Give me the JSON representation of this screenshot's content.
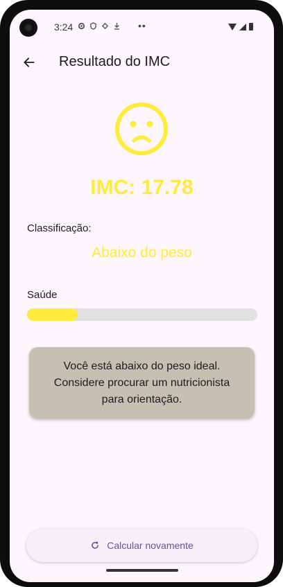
{
  "status_bar": {
    "time": "3:24",
    "dots": "••"
  },
  "app_bar": {
    "title": "Resultado do IMC"
  },
  "result": {
    "imc_text": "IMC: 17.78",
    "imc_value": 17.78,
    "classification_label": "Classificação:",
    "classification_value": "Abaixo do peso",
    "health_label": "Saúde",
    "health_progress": 0.22,
    "message_lines": [
      "Você está abaixo do peso ideal.",
      "Considere procurar um nutricionista",
      "para orientação."
    ]
  },
  "actions": {
    "recalc_label": "Calcular novamente"
  },
  "colors": {
    "accent": "#ffeb3b",
    "card": "#c6c0b3",
    "primary": "#6750a4",
    "background": "#fdf6fd"
  }
}
